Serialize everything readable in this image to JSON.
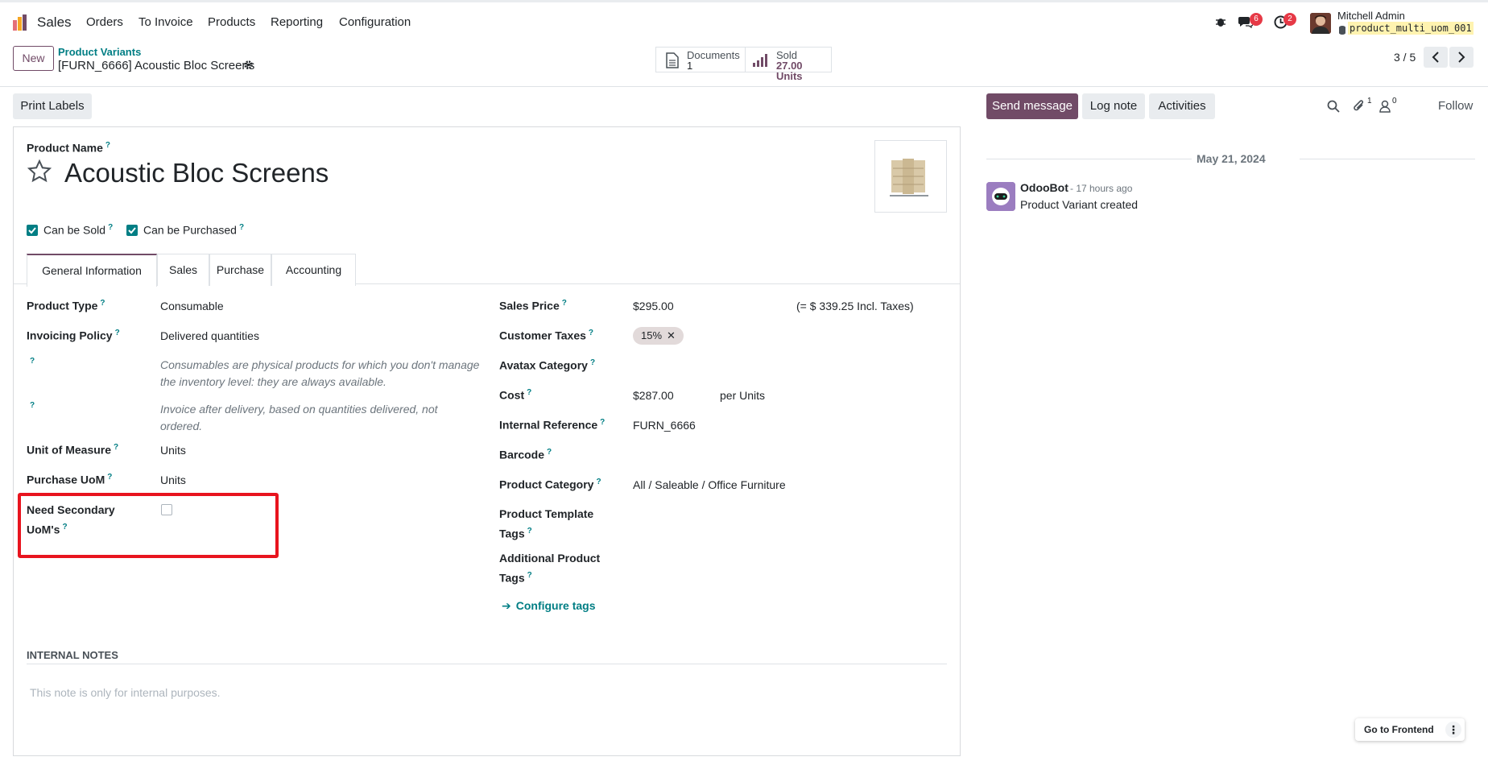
{
  "navbar": {
    "app_name": "Sales",
    "menu": [
      "Orders",
      "To Invoice",
      "Products",
      "Reporting",
      "Configuration"
    ],
    "messages_count": "6",
    "activities_count": "2",
    "user_name": "Mitchell Admin",
    "database": "product_multi_uom_001"
  },
  "control_panel": {
    "new_label": "New",
    "breadcrumb_parent": "Product Variants",
    "record_title": "[FURN_6666] Acoustic Bloc Screens",
    "documents_label": "Documents",
    "documents_count": "1",
    "sold_label": "Sold",
    "sold_value": "27.00 Units",
    "pager": "3 / 5"
  },
  "actions": {
    "print_labels": "Print Labels",
    "send_message": "Send message",
    "log_note": "Log note",
    "activities": "Activities",
    "attachments_count": "1",
    "followers_count": "0",
    "follow": "Follow"
  },
  "form": {
    "product_name_label": "Product Name",
    "product_name": "Acoustic Bloc Screens",
    "can_be_sold": "Can be Sold",
    "can_be_purchased": "Can be Purchased",
    "tabs": [
      "General Information",
      "Sales",
      "Purchase",
      "Accounting"
    ],
    "left": {
      "product_type_label": "Product Type",
      "product_type": "Consumable",
      "invoicing_policy_label": "Invoicing Policy",
      "invoicing_policy": "Delivered quantities",
      "consumable_note": "Consumables are physical products for which you don't manage the inventory level: they are always available.",
      "invoice_note": "Invoice after delivery, based on quantities delivered, not ordered.",
      "uom_label": "Unit of Measure",
      "uom": "Units",
      "purchase_uom_label": "Purchase UoM",
      "purchase_uom": "Units",
      "need_secondary_label": "Need Secondary UoM's"
    },
    "right": {
      "sales_price_label": "Sales Price",
      "sales_price": "$295.00",
      "incl_taxes": "(= $ 339.25 Incl. Taxes)",
      "customer_taxes_label": "Customer Taxes",
      "customer_tax": "15%",
      "avatax_label": "Avatax Category",
      "cost_label": "Cost",
      "cost": "$287.00",
      "cost_unit": "per Units",
      "internal_ref_label": "Internal Reference",
      "internal_ref": "FURN_6666",
      "barcode_label": "Barcode",
      "category_label": "Product Category",
      "category": "All / Saleable / Office Furniture",
      "template_tags_label": "Product Template Tags",
      "additional_tags_label": "Additional Product Tags",
      "configure_tags": "Configure tags"
    },
    "internal_notes_title": "INTERNAL NOTES",
    "internal_notes_placeholder": "This note is only for internal purposes."
  },
  "chatter": {
    "date": "May 21, 2024",
    "author": "OdooBot",
    "time": "- 17 hours ago",
    "message": "Product Variant created"
  },
  "footer": {
    "go_to_frontend": "Go to Frontend"
  },
  "colors": {
    "brand": "#714b67",
    "accent": "#017e84",
    "highlight_box": "#e8141e"
  }
}
